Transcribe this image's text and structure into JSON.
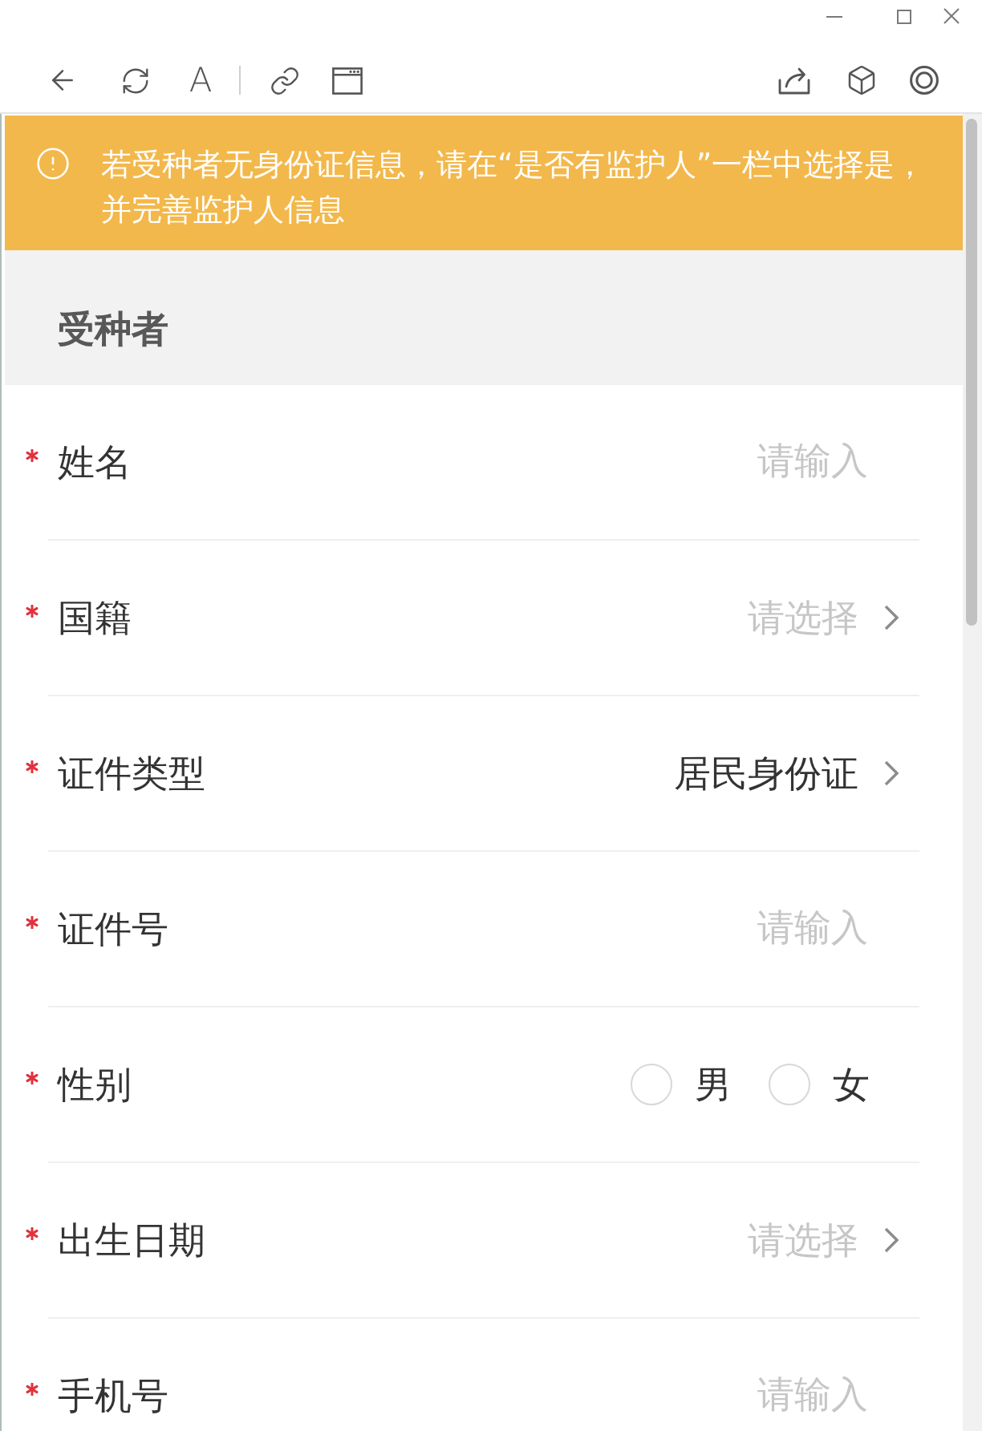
{
  "toolbar": {
    "font_label": "A"
  },
  "notice": {
    "text": "若受种者无身份证信息，请在“是否有监护人”一栏中选择是，并完善监护人信息"
  },
  "section": {
    "title": "受种者"
  },
  "fields": [
    {
      "kind": "input",
      "label": "姓名",
      "required": true,
      "placeholder": "请输入"
    },
    {
      "kind": "select",
      "label": "国籍",
      "required": true,
      "placeholder": "请选择"
    },
    {
      "kind": "select",
      "label": "证件类型",
      "required": true,
      "value": "居民身份证"
    },
    {
      "kind": "input",
      "label": "证件号",
      "required": true,
      "placeholder": "请输入"
    },
    {
      "kind": "radio",
      "label": "性别",
      "required": true,
      "options": [
        {
          "label": "男",
          "selected": false
        },
        {
          "label": "女",
          "selected": false
        }
      ]
    },
    {
      "kind": "select",
      "label": "出生日期",
      "required": true,
      "placeholder": "请选择"
    },
    {
      "kind": "input",
      "label": "手机号",
      "required": true,
      "placeholder": "请输入"
    }
  ]
}
